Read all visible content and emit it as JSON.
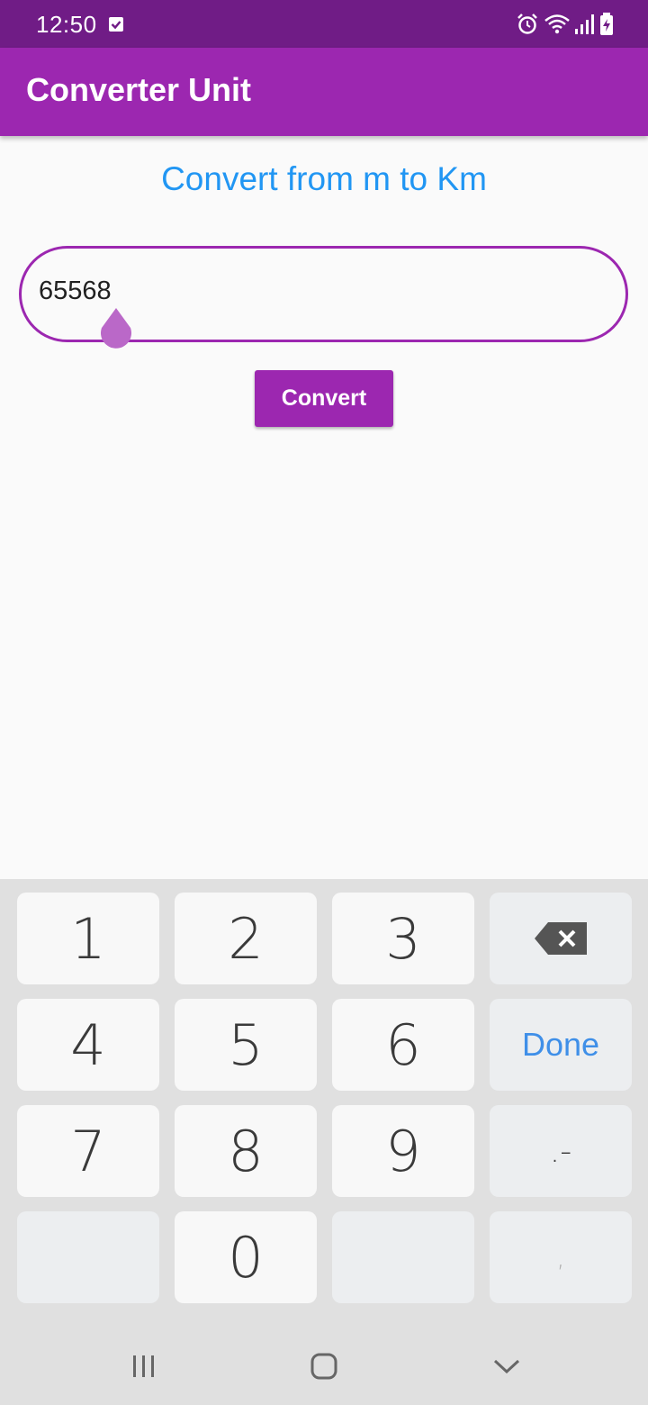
{
  "status_bar": {
    "time": "12:50",
    "icons": [
      "checkbox-notification-icon",
      "alarm-icon",
      "wifi-icon",
      "signal-icon",
      "battery-charging-icon"
    ]
  },
  "app_bar": {
    "title": "Converter Unit",
    "color": "#9c27b0"
  },
  "main": {
    "heading": "Convert from m to Km",
    "input_value": "65568",
    "convert_label": "Convert"
  },
  "keyboard": {
    "keys": [
      "1",
      "2",
      "3",
      "4",
      "5",
      "6",
      "7",
      "8",
      "9",
      "0"
    ],
    "done_label": "Done",
    "symbol_label": ".-",
    "comma_label": ","
  },
  "nav_bar": {
    "icons": [
      "recents-icon",
      "home-icon",
      "back-icon"
    ]
  },
  "colors": {
    "accent": "#9c27b0",
    "status_bar": "#701c86",
    "heading": "#2196f3",
    "done": "#3f8fe8"
  }
}
